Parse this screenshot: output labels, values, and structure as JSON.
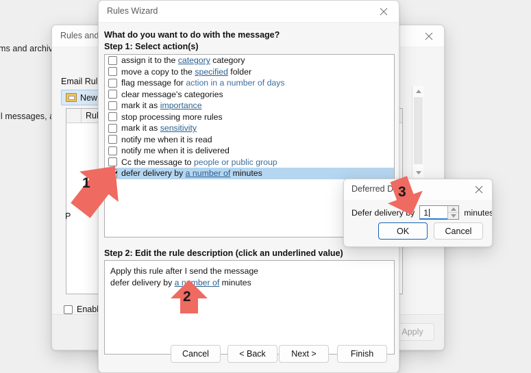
{
  "backdrop": {
    "line1": "ms and archiv",
    "line2": "il messages, a"
  },
  "rules_and_alerts": {
    "title": "Rules and A",
    "close_icon": "close-icon",
    "email_rules_label": "Email Rules",
    "new_rule_button": "New R",
    "new_rule_icon": "new-rule-icon",
    "list_header": "Rule (a",
    "partial_label_p": "P",
    "enable_checkbox_label": "Enable",
    "enable_checked": false,
    "apply_button": "Apply",
    "apply_enabled": false,
    "scrollbar": {
      "up_icon": "triangle-up-icon",
      "down_icon": "triangle-down-icon"
    }
  },
  "rules_wizard": {
    "title": "Rules Wizard",
    "close_icon": "close-icon",
    "question": "What do you want to do with the message?",
    "step1_label": "Step 1: Select action(s)",
    "step2_label": "Step 2: Edit the rule description (click an underlined value)",
    "actions": [
      {
        "checked": false,
        "before": "assign it to the ",
        "link": "category",
        "after": " category"
      },
      {
        "checked": false,
        "before": "move a copy to the ",
        "link": "specified",
        "after": " folder"
      },
      {
        "checked": false,
        "before": "flag message for ",
        "link": "action in a number of days",
        "after": "",
        "link_style": "plain"
      },
      {
        "checked": false,
        "before": "clear message's categories",
        "link": "",
        "after": ""
      },
      {
        "checked": false,
        "before": "mark it as ",
        "link": "importance",
        "after": ""
      },
      {
        "checked": false,
        "before": "stop processing more rules",
        "link": "",
        "after": ""
      },
      {
        "checked": false,
        "before": "mark it as ",
        "link": "sensitivity",
        "after": ""
      },
      {
        "checked": false,
        "before": "notify me when it is read",
        "link": "",
        "after": ""
      },
      {
        "checked": false,
        "before": "notify me when it is delivered",
        "link": "",
        "after": ""
      },
      {
        "checked": false,
        "before": "Cc the message to ",
        "link": "people or public group",
        "after": "",
        "link_style": "plain"
      },
      {
        "checked": true,
        "before": "defer delivery by ",
        "link": "a number of",
        "after": " minutes",
        "selected": true
      }
    ],
    "description": {
      "line1": "Apply this rule after I send the message",
      "line2_before": "defer delivery by ",
      "line2_link": "a number of",
      "line2_after": " minutes"
    },
    "buttons": {
      "cancel": "Cancel",
      "back": "< Back",
      "next": "Next >",
      "finish": "Finish"
    }
  },
  "deferred_dialog": {
    "title": "Deferred D",
    "close_icon": "close-icon",
    "field_label": "Defer delivery by",
    "value": "1",
    "unit_label": "minutes",
    "spinner_up_icon": "spinner-up-icon",
    "spinner_down_icon": "spinner-down-icon",
    "ok_button": "OK",
    "cancel_button": "Cancel"
  },
  "annotations": [
    {
      "number": "1"
    },
    {
      "number": "2"
    },
    {
      "number": "3"
    }
  ],
  "colors": {
    "arrow_red": "#ef6a61",
    "selection_blue": "#b5d6f0",
    "link_blue": "#2a5f8f",
    "focus_underline": "#2d7cd6",
    "default_button_border": "#1464b4"
  }
}
